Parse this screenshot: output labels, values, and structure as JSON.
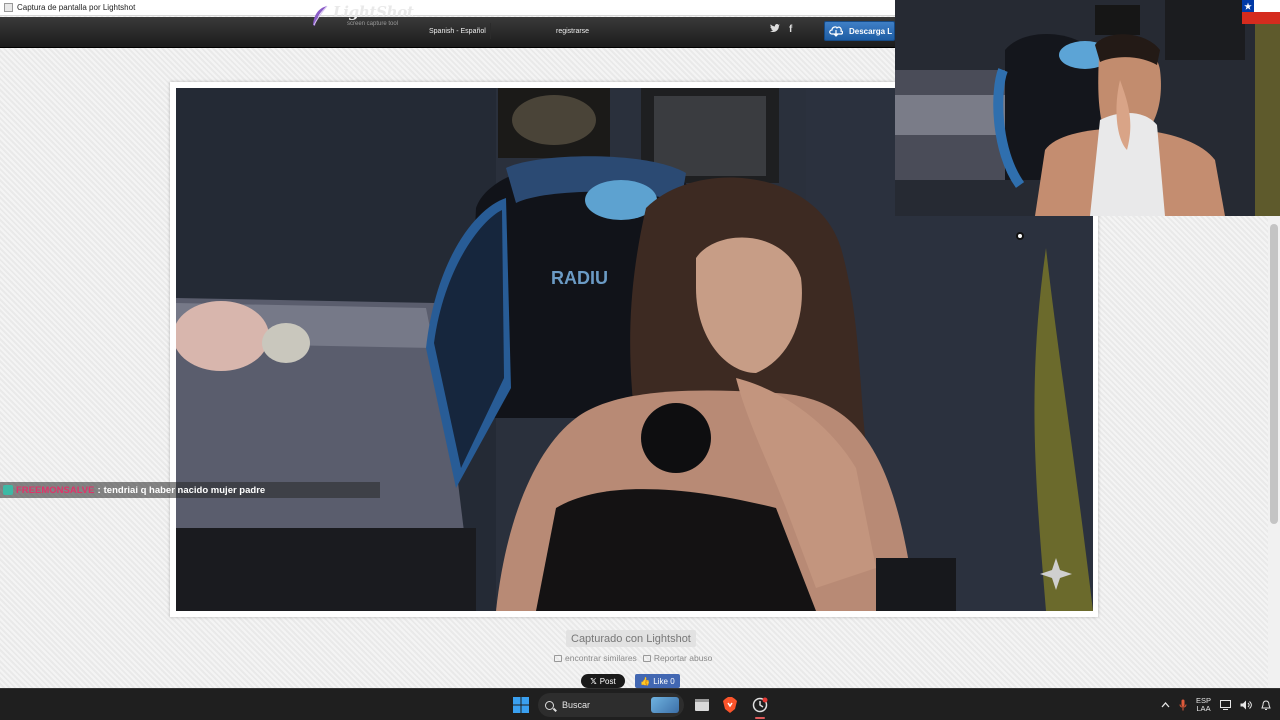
{
  "window": {
    "title": "Captura de pantalla por Lightshot"
  },
  "header": {
    "logo_name": "LightShot",
    "logo_sub": "screen capture tool",
    "language": "Spanish - Español",
    "register": "registrarse",
    "download_label": "Descarga L"
  },
  "chat": {
    "username": "FREEMONSALVE",
    "separator": ":",
    "message": "tendriai q haber nacido mujer padre"
  },
  "footer": {
    "caption": "Capturado con Lightshot",
    "find_similar": "encontrar similares",
    "report_abuse": "Reportar abuso",
    "post_label": "Post",
    "like_label": "Like 0"
  },
  "taskbar": {
    "search_label": "Buscar",
    "lang_top": "ESP",
    "lang_bottom": "LAA"
  },
  "colors": {
    "header_bg": "#262626",
    "download_blue": "#2a6db5",
    "chat_user": "#e0336a",
    "facebook_blue": "#4267b2",
    "taskbar_bg": "#1f1f1f"
  },
  "icons": [
    "feather-logo-icon",
    "twitter-icon",
    "facebook-icon",
    "cloud-download-icon",
    "windows-start-icon",
    "search-icon",
    "file-explorer-icon",
    "brave-icon",
    "browser-app-icon",
    "chevron-up-icon",
    "microphone-icon",
    "wifi-icon",
    "volume-icon",
    "notification-icon",
    "star-sparkle-icon"
  ]
}
